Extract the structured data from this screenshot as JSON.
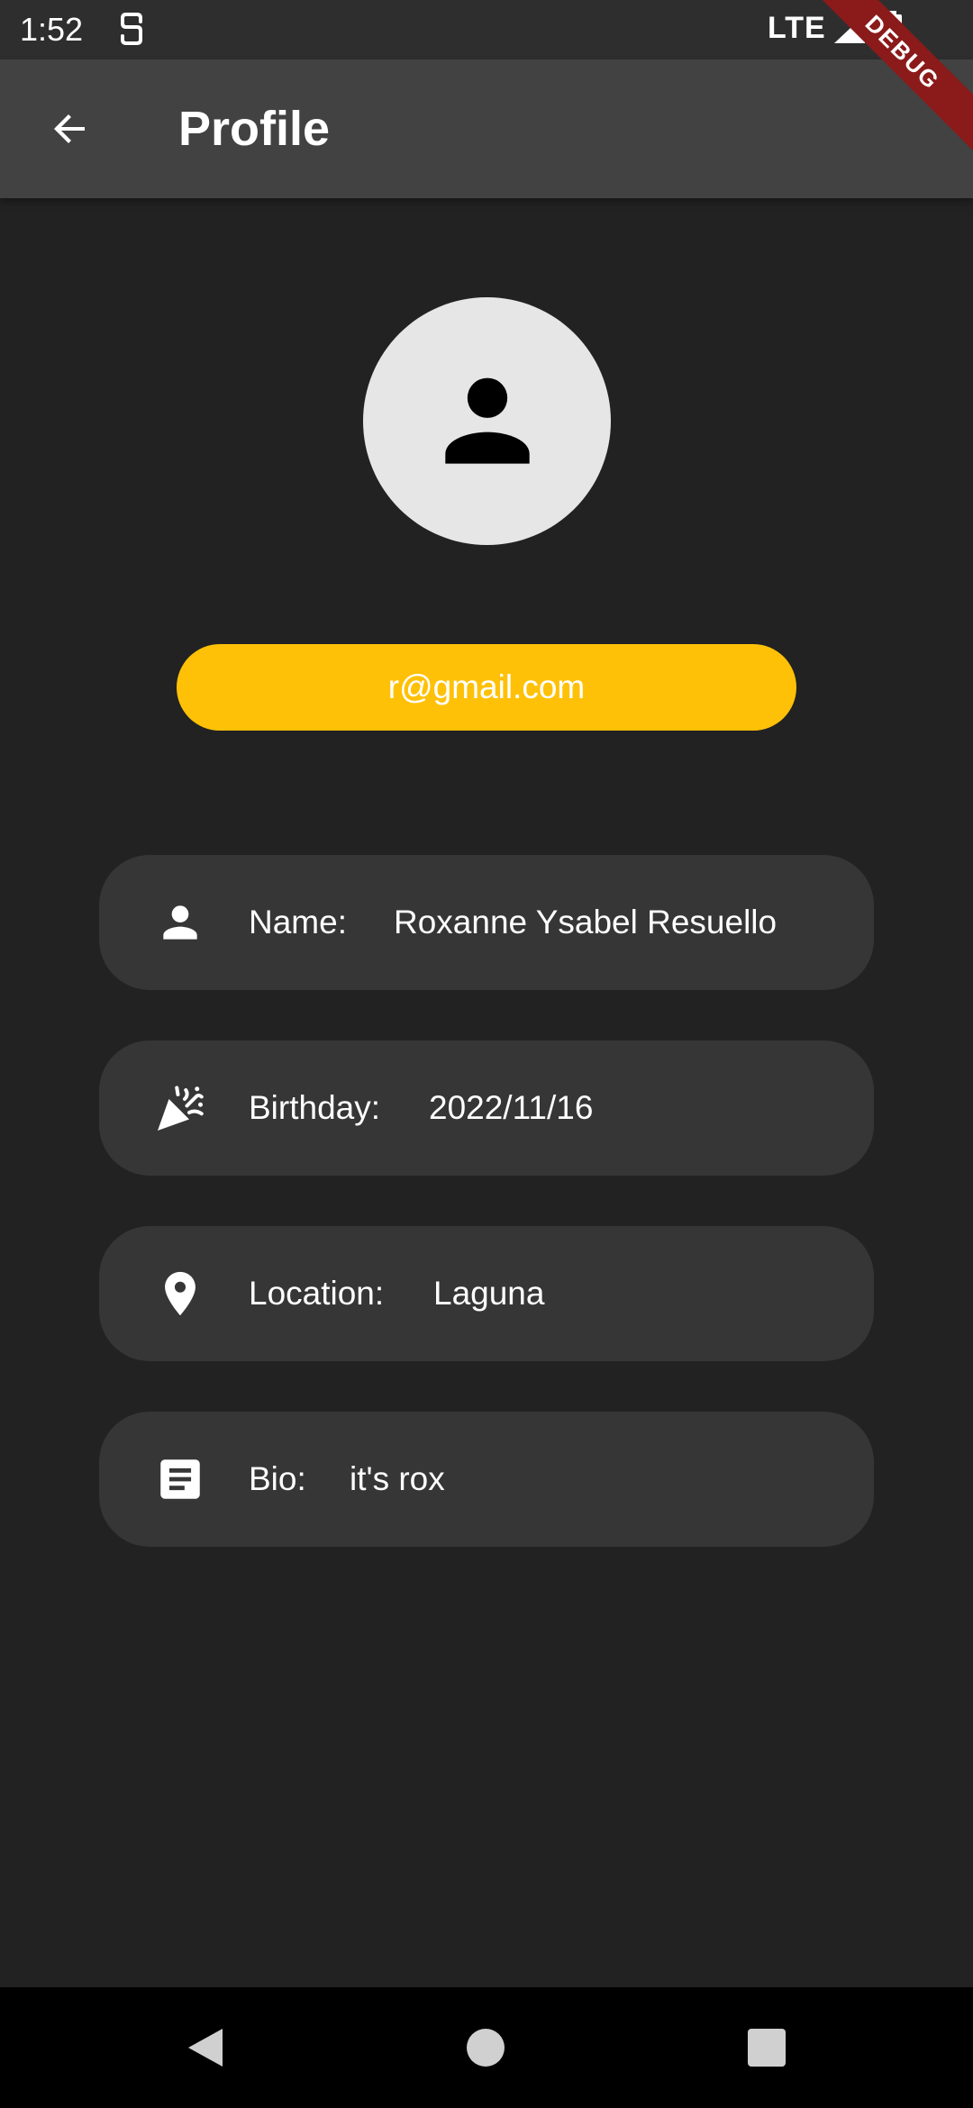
{
  "status_bar": {
    "time": "1:52",
    "network": "LTE",
    "icons": [
      "sim-icon",
      "signal-icon",
      "battery-icon"
    ]
  },
  "app_bar": {
    "title": "Profile",
    "back_icon": "arrow-back-icon"
  },
  "debug_banner": {
    "label": "DEBUG",
    "color": "#8b1a1a"
  },
  "profile": {
    "avatar_icon": "person-icon",
    "email": "r@gmail.com",
    "email_pill_color": "#ffc107",
    "fields": [
      {
        "icon": "person-icon",
        "label": "Name:",
        "value": "Roxanne Ysabel Resuello"
      },
      {
        "icon": "celebration-icon",
        "label": "Birthday:",
        "value": "2022/11/16"
      },
      {
        "icon": "location-pin-icon",
        "label": "Location:",
        "value": "Laguna"
      },
      {
        "icon": "article-icon",
        "label": "Bio:",
        "value": "it's rox"
      }
    ]
  },
  "nav_bar": {
    "buttons": [
      "back-triangle-icon",
      "home-circle-icon",
      "recents-square-icon"
    ]
  },
  "colors": {
    "background": "#222222",
    "app_bar": "#424242",
    "card": "#363636",
    "avatar_bg": "#e6e6e6"
  }
}
